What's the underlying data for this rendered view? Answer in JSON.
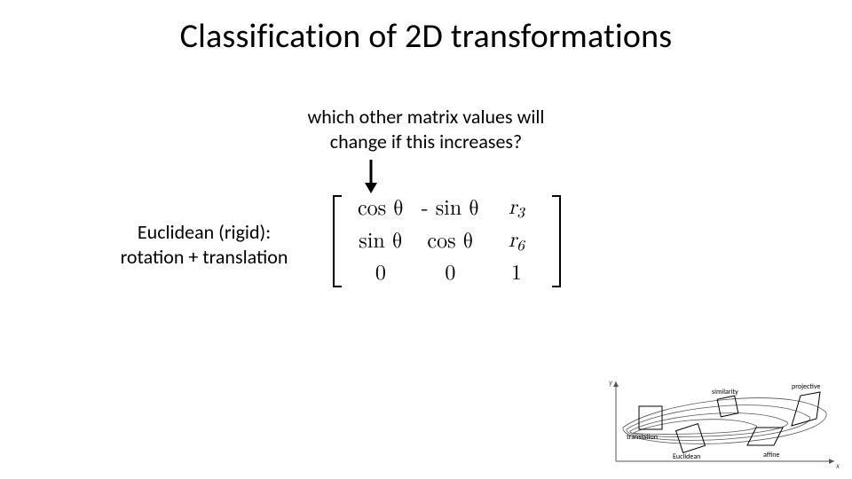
{
  "title": "Classification of 2D transformations",
  "question_line1": "which other matrix values will",
  "question_line2": "change if this increases?",
  "label_left_line1": "Euclidean (rigid):",
  "label_left_line2": "rotation + translation",
  "matrix": {
    "r0c0": "cos θ",
    "r0c1": "- sin θ",
    "r0c2_sym": "r",
    "r0c2_sub": "3",
    "r1c0": "sin θ",
    "r1c1": "cos θ",
    "r1c2_sym": "r",
    "r1c2_sub": "6",
    "r2c0": "0",
    "r2c1": "0",
    "r2c2": "1"
  },
  "diagram": {
    "y_label": "y",
    "x_label": "x",
    "translation": "translation",
    "euclidean": "Euclidean",
    "similarity": "similarity",
    "affine": "affine",
    "projective": "projective"
  }
}
